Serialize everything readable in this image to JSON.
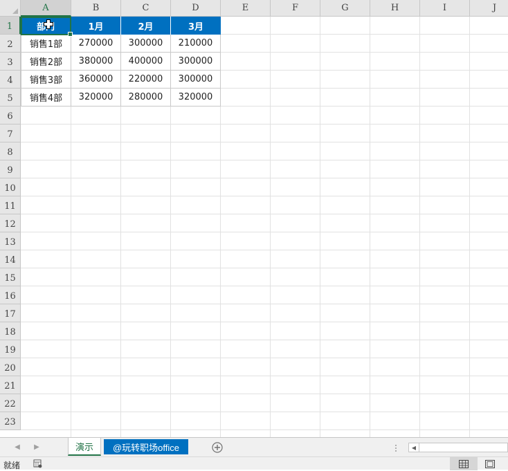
{
  "columns": [
    "A",
    "B",
    "C",
    "D",
    "E",
    "F",
    "G",
    "H",
    "I",
    "J"
  ],
  "rows": [
    "1",
    "2",
    "3",
    "4",
    "5",
    "6",
    "7",
    "8",
    "9",
    "10",
    "11",
    "12",
    "13",
    "14",
    "15",
    "16",
    "17",
    "18",
    "19",
    "20",
    "21",
    "22",
    "23"
  ],
  "table": {
    "header": [
      "部门",
      "1月",
      "2月",
      "3月"
    ],
    "body": [
      [
        "销售1部",
        "270000",
        "300000",
        "210000"
      ],
      [
        "销售2部",
        "380000",
        "400000",
        "300000"
      ],
      [
        "销售3部",
        "360000",
        "220000",
        "300000"
      ],
      [
        "销售4部",
        "320000",
        "280000",
        "320000"
      ]
    ]
  },
  "sheets": {
    "active": "演示",
    "second": "@玩转职场office"
  },
  "status": {
    "text": "就绪"
  },
  "colors": {
    "header_fill": "#0070c0",
    "selection": "#217346"
  }
}
